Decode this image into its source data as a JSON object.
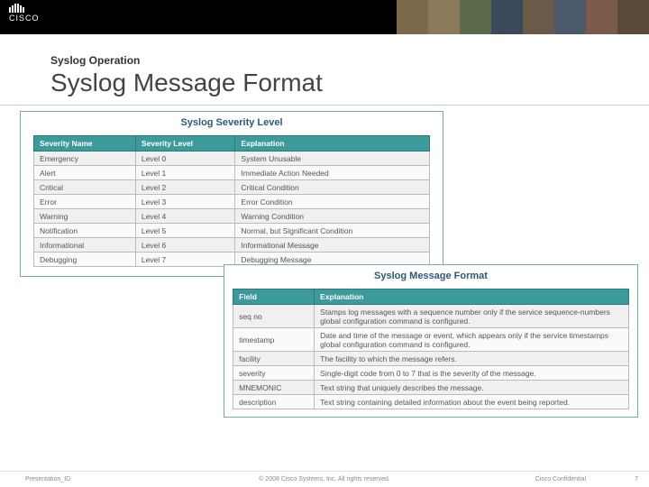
{
  "header": {
    "brand": "CISCO",
    "overtitle": "Syslog Operation",
    "title": "Syslog Message Format"
  },
  "panel_severity": {
    "title": "Syslog Severity Level",
    "cols": [
      "Severity Name",
      "Severity Level",
      "Explanation"
    ],
    "rows": [
      [
        "Emergency",
        "Level 0",
        "System Unusable"
      ],
      [
        "Alert",
        "Level 1",
        "Immediate Action Needed"
      ],
      [
        "Critical",
        "Level 2",
        "Critical Condition"
      ],
      [
        "Error",
        "Level 3",
        "Error Condition"
      ],
      [
        "Warning",
        "Level 4",
        "Warning Condition"
      ],
      [
        "Notification",
        "Level 5",
        "Normal, but Significant Condition"
      ],
      [
        "Informational",
        "Level 6",
        "Informational Message"
      ],
      [
        "Debugging",
        "Level 7",
        "Debugging Message"
      ]
    ]
  },
  "panel_format": {
    "title": "Syslog Message Format",
    "cols": [
      "Field",
      "Explanation"
    ],
    "rows": [
      [
        "seq no",
        "Stamps log messages with a sequence number only if the service sequence-numbers global configuration command is configured."
      ],
      [
        "timestamp",
        "Date and time of the message or event, which appears only if the service timestamps global configuration command is configured."
      ],
      [
        "facility",
        "The facility to which the message refers."
      ],
      [
        "severity",
        "Single-digit code from 0 to 7 that is the severity of the message."
      ],
      [
        "MNEMONIC",
        "Text string that uniquely describes the message."
      ],
      [
        "description",
        "Text string containing detailed information about the event being reported."
      ]
    ]
  },
  "footer": {
    "id": "Presentation_ID",
    "copyright": "© 2008 Cisco Systems, Inc. All rights reserved.",
    "confidential": "Cisco Confidential",
    "page": "7"
  }
}
